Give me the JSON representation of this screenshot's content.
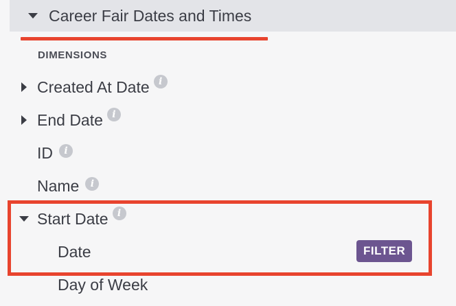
{
  "view": {
    "title": "Career Fair Dates and Times"
  },
  "section": {
    "label": "DIMENSIONS"
  },
  "fields": {
    "created_at": "Created At Date",
    "end_date": "End Date",
    "id": "ID",
    "name": "Name",
    "start_date": "Start Date",
    "start_date_date": "Date",
    "start_date_dow": "Day of Week"
  },
  "info_icon_glyph": "i",
  "filter_label": "FILTER",
  "colors": {
    "header_bg": "#e3e4e8",
    "annotation_red": "#e8442e",
    "filter_purple": "#6c5590",
    "info_gray": "#c6c8ce"
  }
}
